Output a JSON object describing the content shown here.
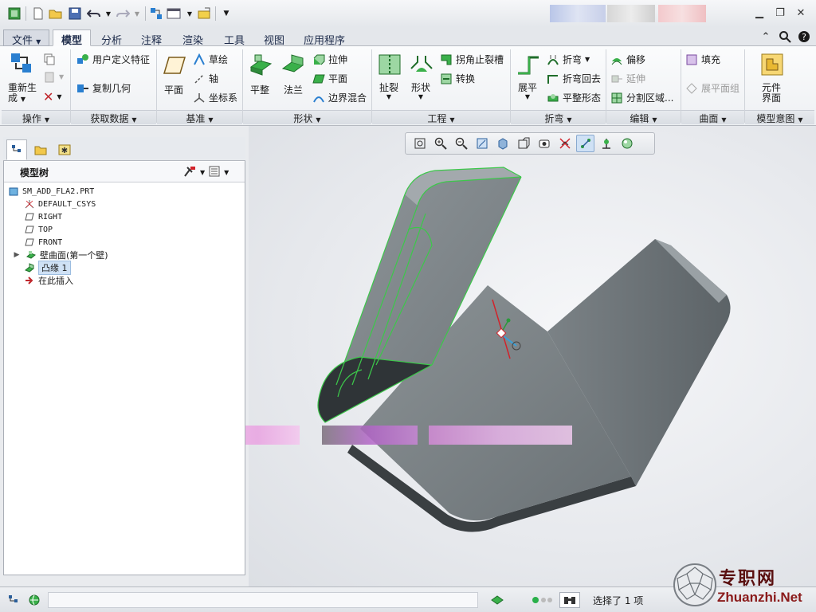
{
  "qat": {
    "icons": [
      "app-icon",
      "new-icon",
      "open-icon",
      "save-icon",
      "undo-icon",
      "redo-icon",
      "regenerate-icon",
      "windows-icon",
      "close-window-icon",
      "customize-icon"
    ]
  },
  "tabs": {
    "file": "文件",
    "items": [
      "模型",
      "分析",
      "注释",
      "渲染",
      "工具",
      "视图",
      "应用程序"
    ],
    "active": "模型"
  },
  "ribbon": {
    "ops": {
      "regen": "重新生成",
      "regen_l1": "重新生",
      "regen_l2": "成"
    },
    "getdata": {
      "udf": "用户定义特征",
      "copygeom": "复制几何"
    },
    "datum": {
      "plane": "平面",
      "sketch": "草绘",
      "axis": "轴",
      "csys": "坐标系"
    },
    "shapes": {
      "flat": "平整",
      "flange": "法兰",
      "extrude": "拉伸",
      "planar": "平面",
      "blend": "边界混合"
    },
    "engineering": {
      "rip": "扯裂",
      "form": "形状",
      "corner_relief": "拐角止裂槽",
      "convert": "转换"
    },
    "bends": {
      "unbend": "展平",
      "bend": "折弯",
      "bend_back": "折弯回去",
      "flatten_form": "平整形态"
    },
    "editing": {
      "offset": "偏移",
      "extend": "延伸",
      "split_area": "分割区域..."
    },
    "surfaces": {
      "fill": "填充",
      "flat_pattern": "展平面组"
    },
    "intent": {
      "component_interface_l1": "元件",
      "component_interface_l2": "界面"
    },
    "groups": [
      "操作",
      "获取数据",
      "基准",
      "形状",
      "工程",
      "折弯",
      "编辑",
      "曲面",
      "模型意图"
    ]
  },
  "modeltree": {
    "title": "模型树",
    "items": [
      {
        "label": "SM_ADD_FLA2.PRT",
        "icon": "part-icon"
      },
      {
        "label": "DEFAULT_CSYS",
        "icon": "csys-icon"
      },
      {
        "label": "RIGHT",
        "icon": "datum-plane-icon"
      },
      {
        "label": "TOP",
        "icon": "datum-plane-icon"
      },
      {
        "label": "FRONT",
        "icon": "datum-plane-icon"
      },
      {
        "label": "壁曲面(第一个壁)",
        "icon": "wall-icon"
      },
      {
        "label": "凸缘 1",
        "icon": "flange-icon"
      },
      {
        "label": "在此插入",
        "icon": "insert-arrow-icon"
      }
    ]
  },
  "status": {
    "selected": "选择了 1 项"
  },
  "watermark": {
    "cn": "专职网",
    "en": "Zhuanzhi.Net"
  },
  "colors": {
    "accent": "#1f7fcf",
    "highlight": "#3cc84a",
    "tab_text": "#1d2b4a"
  }
}
